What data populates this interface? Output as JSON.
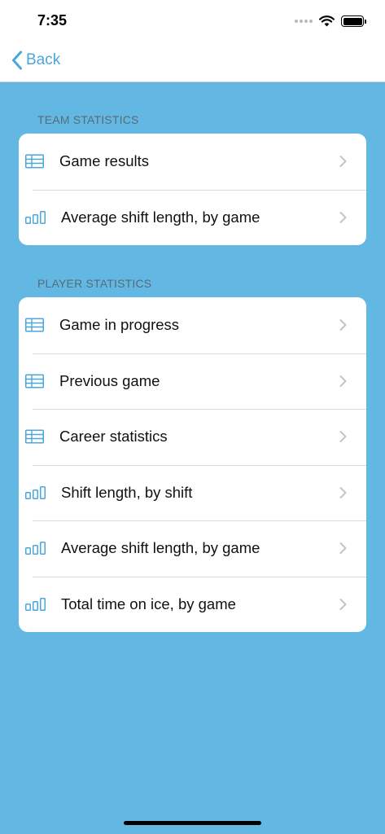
{
  "status_bar": {
    "time": "7:35"
  },
  "nav": {
    "back_label": "Back"
  },
  "colors": {
    "accent": "#4aa7dc",
    "background": "#63b8e3",
    "chevron": "#c4c4c8"
  },
  "sections": [
    {
      "header": "TEAM STATISTICS",
      "items": [
        {
          "icon": "table-icon",
          "label": "Game results"
        },
        {
          "icon": "bar-chart-icon",
          "label": "Average shift length, by game"
        }
      ]
    },
    {
      "header": "PLAYER STATISTICS",
      "items": [
        {
          "icon": "table-icon",
          "label": "Game in progress"
        },
        {
          "icon": "table-icon",
          "label": "Previous game"
        },
        {
          "icon": "table-icon",
          "label": "Career statistics"
        },
        {
          "icon": "bar-chart-icon",
          "label": "Shift length, by shift"
        },
        {
          "icon": "bar-chart-icon",
          "label": "Average shift length, by game"
        },
        {
          "icon": "bar-chart-icon",
          "label": "Total time on ice, by game"
        }
      ]
    }
  ]
}
